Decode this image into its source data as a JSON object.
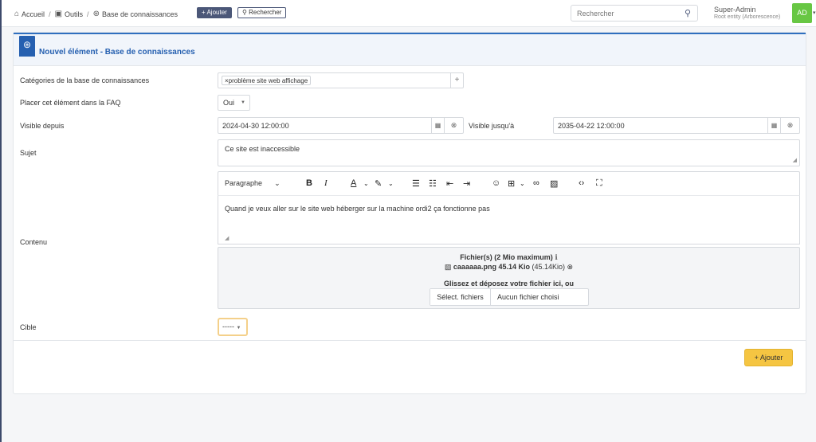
{
  "breadcrumb": {
    "home": "Accueil",
    "tools": "Outils",
    "kb": "Base de connaissances"
  },
  "header": {
    "add_label": "+ Ajouter",
    "search_label": "Rechercher",
    "search_placeholder": "Rechercher"
  },
  "user": {
    "name": "Super-Admin",
    "entity": "Root entity (Arborescence)",
    "initials": "AD",
    "avatar_color": "#68c744"
  },
  "card": {
    "title": "Nouvel élément - Base de connaissances"
  },
  "form": {
    "categories_label": "Catégories de la base de connaissances",
    "category_tag": "×problème site web affichage",
    "faq_label": "Placer cet élément dans la FAQ",
    "faq_value": "Oui",
    "visible_from_label": "Visible depuis",
    "visible_from_value": "2024-04-30 12:00:00",
    "visible_until_label": "Visible jusqu'à",
    "visible_until_value": "2035-04-22 12:00:00",
    "subject_label": "Sujet",
    "subject_value": "Ce site est inaccessible",
    "content_label": "Contenu",
    "paragraph_format": "Paragraphe",
    "content_text": "Quand je veux aller sur le site web héberger sur la machine ordi2 ça fonctionne pas",
    "files_title": "Fichier(s) (2 Mio maximum)",
    "file_name": "caaaaaa.png 45.14 Kio",
    "file_size": "(45.14Kio)",
    "drop_text": "Glissez et déposez votre fichier ici, ou",
    "select_files": "Sélect. fichiers",
    "no_file": "Aucun fichier choisi",
    "target_label": "Cible",
    "target_value": "-----",
    "submit_label": "+ Ajouter"
  },
  "colors": {
    "accent": "#2660b0",
    "submit": "#f5c542",
    "nav": "#4b5778"
  }
}
